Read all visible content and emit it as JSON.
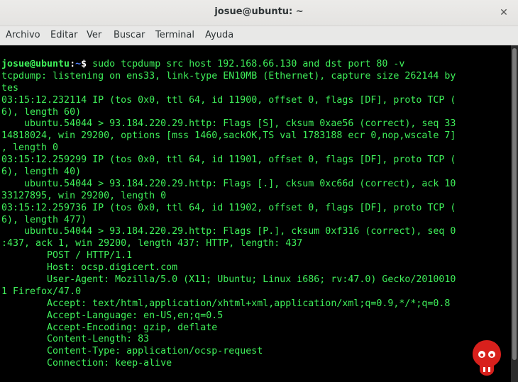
{
  "window": {
    "title": "josue@ubuntu: ~",
    "close_glyph": "✕"
  },
  "menubar": {
    "items": [
      "Archivo",
      "Editar",
      "Ver",
      "Buscar",
      "Terminal",
      "Ayuda"
    ]
  },
  "terminal": {
    "prompt": {
      "user_host": "josue@ubuntu",
      "separator": ":",
      "path": "~",
      "symbol": "$",
      "command": " sudo tcpdump src host 192.168.66.130 and dst port 80 -v"
    },
    "output_lines": [
      "tcpdump: listening on ens33, link-type EN10MB (Ethernet), capture size 262144 by",
      "tes",
      "03:15:12.232114 IP (tos 0x0, ttl 64, id 11900, offset 0, flags [DF], proto TCP (",
      "6), length 60)",
      "    ubuntu.54044 > 93.184.220.29.http: Flags [S], cksum 0xae56 (correct), seq 33",
      "14818024, win 29200, options [mss 1460,sackOK,TS val 1783188 ecr 0,nop,wscale 7]",
      ", length 0",
      "03:15:12.259299 IP (tos 0x0, ttl 64, id 11901, offset 0, flags [DF], proto TCP (",
      "6), length 40)",
      "    ubuntu.54044 > 93.184.220.29.http: Flags [.], cksum 0xc66d (correct), ack 10",
      "33127895, win 29200, length 0",
      "03:15:12.259736 IP (tos 0x0, ttl 64, id 11902, offset 0, flags [DF], proto TCP (",
      "6), length 477)",
      "    ubuntu.54044 > 93.184.220.29.http: Flags [P.], cksum 0xf316 (correct), seq 0",
      ":437, ack 1, win 29200, length 437: HTTP, length: 437",
      "        POST / HTTP/1.1",
      "        Host: ocsp.digicert.com",
      "        User-Agent: Mozilla/5.0 (X11; Ubuntu; Linux i686; rv:47.0) Gecko/2010010",
      "1 Firefox/47.0",
      "        Accept: text/html,application/xhtml+xml,application/xml;q=0.9,*/*;q=0.8",
      "        Accept-Language: en-US,en;q=0.5",
      "        Accept-Encoding: gzip, deflate",
      "        Content-Length: 83",
      "        Content-Type: application/ocsp-request",
      "        Connection: keep-alive"
    ]
  },
  "colors": {
    "terminal_bg": "#000000",
    "terminal_fg": "#3ff05a",
    "prompt_path": "#4f7fff",
    "watermark": "#d8201c"
  },
  "watermark": {
    "icon": "logo-icon"
  }
}
